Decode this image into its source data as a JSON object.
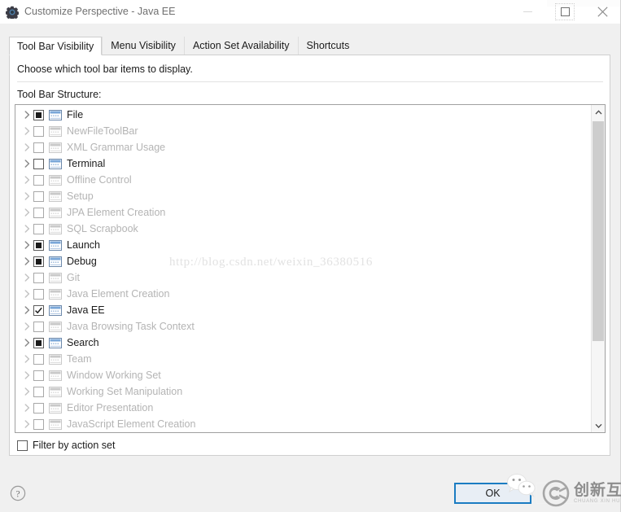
{
  "window": {
    "title": "Customize Perspective - Java EE",
    "icon": "gear-icon",
    "controls": {
      "minimize": "Minimize",
      "maximize": "Maximize",
      "close": "Close"
    }
  },
  "tabs": [
    {
      "label": "Tool Bar Visibility",
      "selected": true
    },
    {
      "label": "Menu Visibility",
      "selected": false
    },
    {
      "label": "Action Set Availability",
      "selected": false
    },
    {
      "label": "Shortcuts",
      "selected": false
    }
  ],
  "panel": {
    "instruction": "Choose which tool bar items to display.",
    "structure_label": "Tool Bar Structure:"
  },
  "tree": {
    "items": [
      {
        "label": "File",
        "state": "partial",
        "enabled": true
      },
      {
        "label": "NewFileToolBar",
        "state": "unchecked",
        "enabled": false
      },
      {
        "label": "XML Grammar Usage",
        "state": "unchecked",
        "enabled": false
      },
      {
        "label": "Terminal",
        "state": "unchecked",
        "enabled": true
      },
      {
        "label": "Offline Control",
        "state": "unchecked",
        "enabled": false
      },
      {
        "label": "Setup",
        "state": "unchecked",
        "enabled": false
      },
      {
        "label": "JPA Element Creation",
        "state": "unchecked",
        "enabled": false
      },
      {
        "label": "SQL Scrapbook",
        "state": "unchecked",
        "enabled": false
      },
      {
        "label": "Launch",
        "state": "partial",
        "enabled": true
      },
      {
        "label": "Debug",
        "state": "partial",
        "enabled": true
      },
      {
        "label": "Git",
        "state": "unchecked",
        "enabled": false
      },
      {
        "label": "Java Element Creation",
        "state": "unchecked",
        "enabled": false
      },
      {
        "label": "Java EE",
        "state": "checked",
        "enabled": true
      },
      {
        "label": "Java Browsing Task Context",
        "state": "unchecked",
        "enabled": false
      },
      {
        "label": "Search",
        "state": "partial",
        "enabled": true
      },
      {
        "label": "Team",
        "state": "unchecked",
        "enabled": false
      },
      {
        "label": "Window Working Set",
        "state": "unchecked",
        "enabled": false
      },
      {
        "label": "Working Set Manipulation",
        "state": "unchecked",
        "enabled": false
      },
      {
        "label": "Editor Presentation",
        "state": "unchecked",
        "enabled": false
      },
      {
        "label": "JavaScript Element Creation",
        "state": "unchecked",
        "enabled": false
      }
    ]
  },
  "filter": {
    "label": "Filter by action set",
    "checked": false
  },
  "buttons": {
    "ok": "OK",
    "help": "?"
  },
  "watermarks": {
    "url": "http://blog.csdn.net/weixin_36380516",
    "brand_cn": "创新互联",
    "brand_en": "CHUANG XIN HU LIAN"
  },
  "colors": {
    "accent": "#1b7cc2",
    "dialog_bg": "#f0f0f0",
    "panel_bg": "#ffffff",
    "icon_blue": "#7aa7d8",
    "disabled_text": "#b4b4b4"
  }
}
